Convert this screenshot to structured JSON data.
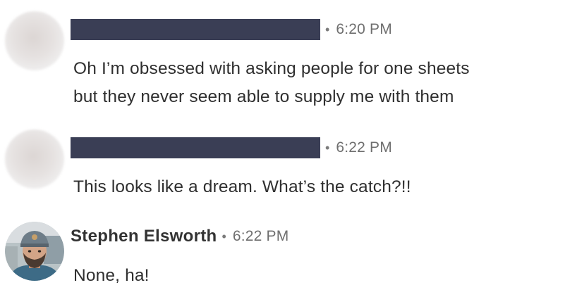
{
  "messages": [
    {
      "author": "",
      "author_redacted": true,
      "time": "6:20 PM",
      "lines": [
        "Oh I’m obsessed with asking people for one sheets",
        "but they never seem able to supply me with them"
      ]
    },
    {
      "author": "",
      "author_redacted": true,
      "time": "6:22 PM",
      "lines": [
        "This looks like a dream. What’s the catch?!!"
      ]
    },
    {
      "author": "Stephen Elsworth",
      "author_redacted": false,
      "time": "6:22 PM",
      "lines": [
        "None, ha!"
      ]
    }
  ],
  "separator": "•",
  "colors": {
    "redaction": "#3a3e55",
    "timestamp": "#6f6f6f",
    "text": "#2f2f2f"
  }
}
